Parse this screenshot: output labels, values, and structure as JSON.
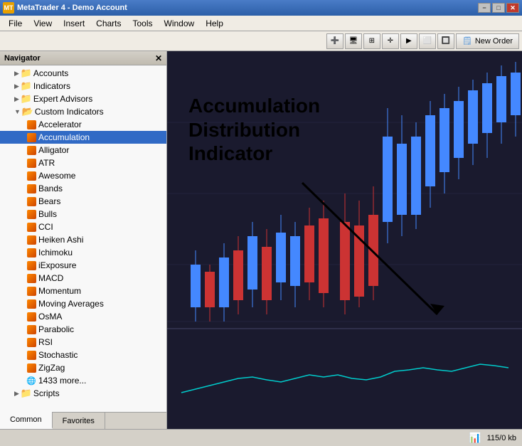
{
  "app": {
    "title": "MetaTrader 4 - Demo Account",
    "icon": "MT"
  },
  "titlebar": {
    "minimize": "−",
    "maximize": "□",
    "close": "✕"
  },
  "menu": {
    "items": [
      "File",
      "View",
      "Insert",
      "Charts",
      "Tools",
      "Window",
      "Help"
    ]
  },
  "toolbar": {
    "new_order": "New Order"
  },
  "navigator": {
    "title": "Navigator",
    "close": "✕",
    "sections": [
      {
        "label": "Accounts",
        "level": 1,
        "expanded": false,
        "icon": "folder"
      },
      {
        "label": "Indicators",
        "level": 1,
        "expanded": false,
        "icon": "folder"
      },
      {
        "label": "Expert Advisors",
        "level": 1,
        "expanded": false,
        "icon": "folder"
      },
      {
        "label": "Custom Indicators",
        "level": 1,
        "expanded": true,
        "icon": "folder"
      }
    ],
    "indicators": [
      {
        "label": "Accelerator",
        "selected": false
      },
      {
        "label": "Accumulation",
        "selected": true
      },
      {
        "label": "Alligator",
        "selected": false
      },
      {
        "label": "ATR",
        "selected": false
      },
      {
        "label": "Awesome",
        "selected": false
      },
      {
        "label": "Bands",
        "selected": false
      },
      {
        "label": "Bears",
        "selected": false
      },
      {
        "label": "Bulls",
        "selected": false
      },
      {
        "label": "CCI",
        "selected": false
      },
      {
        "label": "Heiken Ashi",
        "selected": false
      },
      {
        "label": "Ichimoku",
        "selected": false
      },
      {
        "label": "iExposure",
        "selected": false
      },
      {
        "label": "MACD",
        "selected": false
      },
      {
        "label": "Momentum",
        "selected": false
      },
      {
        "label": "Moving Averages",
        "selected": false
      },
      {
        "label": "OsMA",
        "selected": false
      },
      {
        "label": "Parabolic",
        "selected": false
      },
      {
        "label": "RSI",
        "selected": false
      },
      {
        "label": "Stochastic",
        "selected": false
      },
      {
        "label": "ZigZag",
        "selected": false
      },
      {
        "label": "1433 more...",
        "selected": false
      }
    ],
    "scripts_label": "Scripts",
    "tabs": [
      "Common",
      "Favorites"
    ]
  },
  "annotation": {
    "line1": "Accumulation",
    "line2": "Distribution",
    "line3": "Indicator"
  },
  "statusbar": {
    "size": "115/0 kb"
  }
}
